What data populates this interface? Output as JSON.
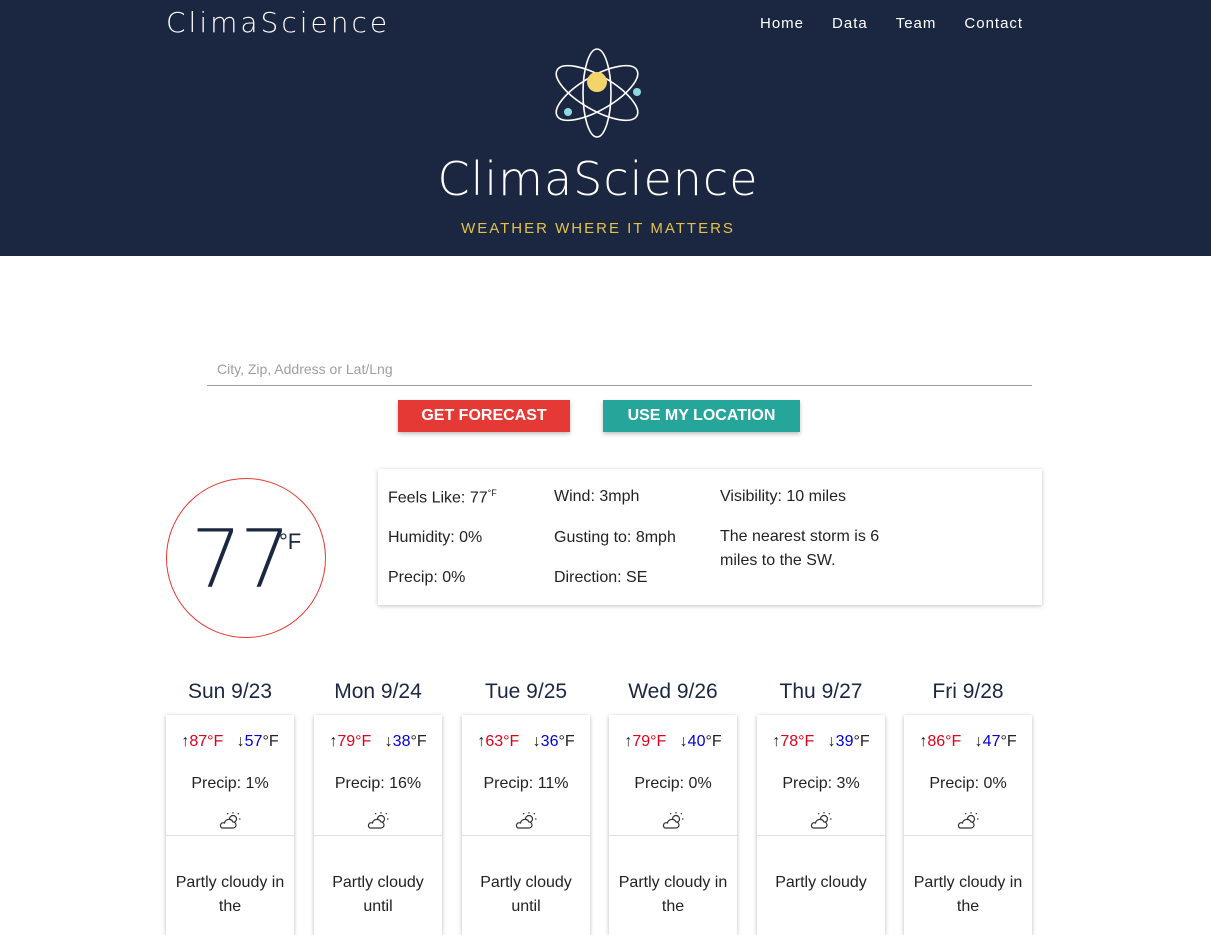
{
  "nav": {
    "brand": "ClimaScience",
    "links": [
      "Home",
      "Data",
      "Team",
      "Contact"
    ]
  },
  "hero": {
    "title": "ClimaScience",
    "tagline": "WEATHER WHERE IT MATTERS"
  },
  "search": {
    "placeholder": "City, Zip, Address or Lat/Lng",
    "forecast_button": "GET FORECAST",
    "location_button": "USE MY LOCATION"
  },
  "current": {
    "temp": "77",
    "unit": "°F",
    "feels_like": "Feels Like: 77",
    "feels_like_unit": "°F",
    "humidity": "Humidity: 0%",
    "precip": "Precip: 0%",
    "wind": "Wind: 3mph",
    "gusting": "Gusting to: 8mph",
    "direction": "Direction: SE",
    "visibility": "Visibility: 10 miles",
    "storm": "The nearest storm is 6 miles to the SW."
  },
  "forecast": [
    {
      "day": "Sun 9/23",
      "high": "87",
      "low": "57",
      "precip": "Precip: 1%",
      "summary": "Partly cloudy in the"
    },
    {
      "day": "Mon 9/24",
      "high": "79",
      "low": "38",
      "precip": "Precip: 16%",
      "summary": "Partly cloudy until"
    },
    {
      "day": "Tue 9/25",
      "high": "63",
      "low": "36",
      "precip": "Precip: 11%",
      "summary": "Partly cloudy until"
    },
    {
      "day": "Wed 9/26",
      "high": "79",
      "low": "40",
      "precip": "Precip: 0%",
      "summary": "Partly cloudy in the"
    },
    {
      "day": "Thu 9/27",
      "high": "78",
      "low": "39",
      "precip": "Precip: 3%",
      "summary": "Partly cloudy"
    },
    {
      "day": "Fri 9/28",
      "high": "86",
      "low": "47",
      "precip": "Precip: 0%",
      "summary": "Partly cloudy in the"
    }
  ],
  "symbols": {
    "up": "↑",
    "down": "↓",
    "deg_f": "°F"
  },
  "icons": {
    "logo": "atom-logo-icon",
    "weather": "partly-cloudy-icon"
  },
  "colors": {
    "header_bg": "#1b2741",
    "tagline": "#e4c24a",
    "forecast_button": "#e53935",
    "location_button": "#26a69a",
    "high_temp": "#e0001b",
    "low_temp": "#0000d8"
  }
}
